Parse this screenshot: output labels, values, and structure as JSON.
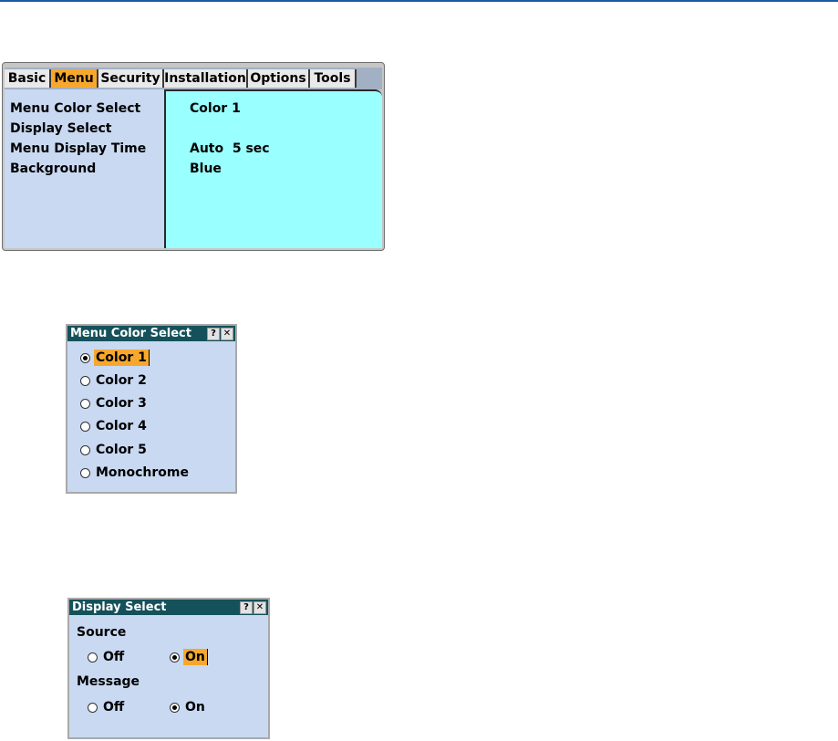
{
  "main_menu": {
    "tabs": [
      {
        "label": "Basic",
        "active": false
      },
      {
        "label": "Menu",
        "active": true
      },
      {
        "label": "Security",
        "active": false
      },
      {
        "label": "Installation",
        "active": false
      },
      {
        "label": "Options",
        "active": false
      },
      {
        "label": "Tools",
        "active": false
      }
    ],
    "items": [
      {
        "label": "Menu Color Select",
        "value": "Color 1"
      },
      {
        "label": "Display Select",
        "value": ""
      },
      {
        "label": "Menu Display Time",
        "value": "Auto  5 sec"
      },
      {
        "label": "Background",
        "value": "Blue"
      }
    ],
    "colors": {
      "active_tab": "#f7a82c",
      "list_bg": "#c9d9f2",
      "value_bg": "#99ffff"
    }
  },
  "menu_color_dialog": {
    "title": "Menu Color Select",
    "help_icon": "?",
    "close_icon": "✕",
    "options": [
      {
        "label": "Color 1",
        "selected": true
      },
      {
        "label": "Color 2",
        "selected": false
      },
      {
        "label": "Color 3",
        "selected": false
      },
      {
        "label": "Color 4",
        "selected": false
      },
      {
        "label": "Color 5",
        "selected": false
      },
      {
        "label": "Monochrome",
        "selected": false
      }
    ]
  },
  "display_select_dialog": {
    "title": "Display Select",
    "help_icon": "?",
    "close_icon": "✕",
    "source": {
      "label": "Source",
      "off_label": "Off",
      "on_label": "On",
      "selected": "On"
    },
    "message": {
      "label": "Message",
      "off_label": "Off",
      "on_label": "On",
      "selected": "On"
    },
    "colors": {
      "title_bar": "#15515a",
      "highlight": "#f7a82c"
    }
  }
}
